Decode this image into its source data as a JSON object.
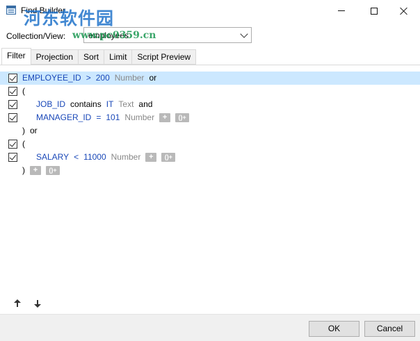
{
  "window": {
    "title": "Find Builder",
    "watermark": "河东软件园",
    "watermark_url": "www.pc0359.cn"
  },
  "collection": {
    "label": "Collection/View:",
    "value": "employees"
  },
  "tabs": [
    {
      "label": "Filter",
      "active": true
    },
    {
      "label": "Projection",
      "active": false
    },
    {
      "label": "Sort",
      "active": false
    },
    {
      "label": "Limit",
      "active": false
    },
    {
      "label": "Script Preview",
      "active": false
    }
  ],
  "filter": {
    "rows": [
      {
        "checked": true,
        "selected": true,
        "indent": 0,
        "tokens": [
          {
            "t": "EMPLOYEE_ID",
            "k": "field"
          },
          {
            "t": ">",
            "k": "op"
          },
          {
            "t": "200",
            "k": "num"
          },
          {
            "t": "Number",
            "k": "typ"
          },
          {
            "t": "or",
            "k": "kw"
          }
        ]
      },
      {
        "checked": true,
        "selected": false,
        "indent": 0,
        "tokens": [
          {
            "t": "(",
            "k": "plain"
          }
        ]
      },
      {
        "checked": true,
        "selected": false,
        "indent": 1,
        "tokens": [
          {
            "t": "JOB_ID",
            "k": "field"
          },
          {
            "t": "contains",
            "k": "kw"
          },
          {
            "t": "IT",
            "k": "num"
          },
          {
            "t": "Text",
            "k": "typ"
          },
          {
            "t": "and",
            "k": "kw"
          }
        ]
      },
      {
        "checked": true,
        "selected": false,
        "indent": 1,
        "buttons": true,
        "tokens": [
          {
            "t": "MANAGER_ID",
            "k": "field"
          },
          {
            "t": "=",
            "k": "op"
          },
          {
            "t": "101",
            "k": "num"
          },
          {
            "t": "Number",
            "k": "typ"
          }
        ]
      },
      {
        "checked": false,
        "selected": false,
        "indent": 0,
        "tokens": [
          {
            "t": ")",
            "k": "plain"
          },
          {
            "t": "or",
            "k": "kw"
          }
        ]
      },
      {
        "checked": true,
        "selected": false,
        "indent": 0,
        "tokens": [
          {
            "t": "(",
            "k": "plain"
          }
        ]
      },
      {
        "checked": true,
        "selected": false,
        "indent": 1,
        "buttons": true,
        "tokens": [
          {
            "t": "SALARY",
            "k": "field"
          },
          {
            "t": "<",
            "k": "op"
          },
          {
            "t": "11000",
            "k": "num"
          },
          {
            "t": "Number",
            "k": "typ"
          }
        ]
      },
      {
        "checked": false,
        "selected": false,
        "indent": 0,
        "buttons": true,
        "tokens": [
          {
            "t": ")",
            "k": "plain"
          }
        ]
      }
    ],
    "add_button": "+",
    "group_button": "()+"
  },
  "footer": {
    "ok_label": "OK",
    "cancel_label": "Cancel"
  },
  "colors": {
    "selection": "#cce8ff",
    "field": "#1a48b8",
    "type": "#888888"
  },
  "icons": {
    "move_up": "arrow-up-icon",
    "move_down": "arrow-down-icon"
  }
}
